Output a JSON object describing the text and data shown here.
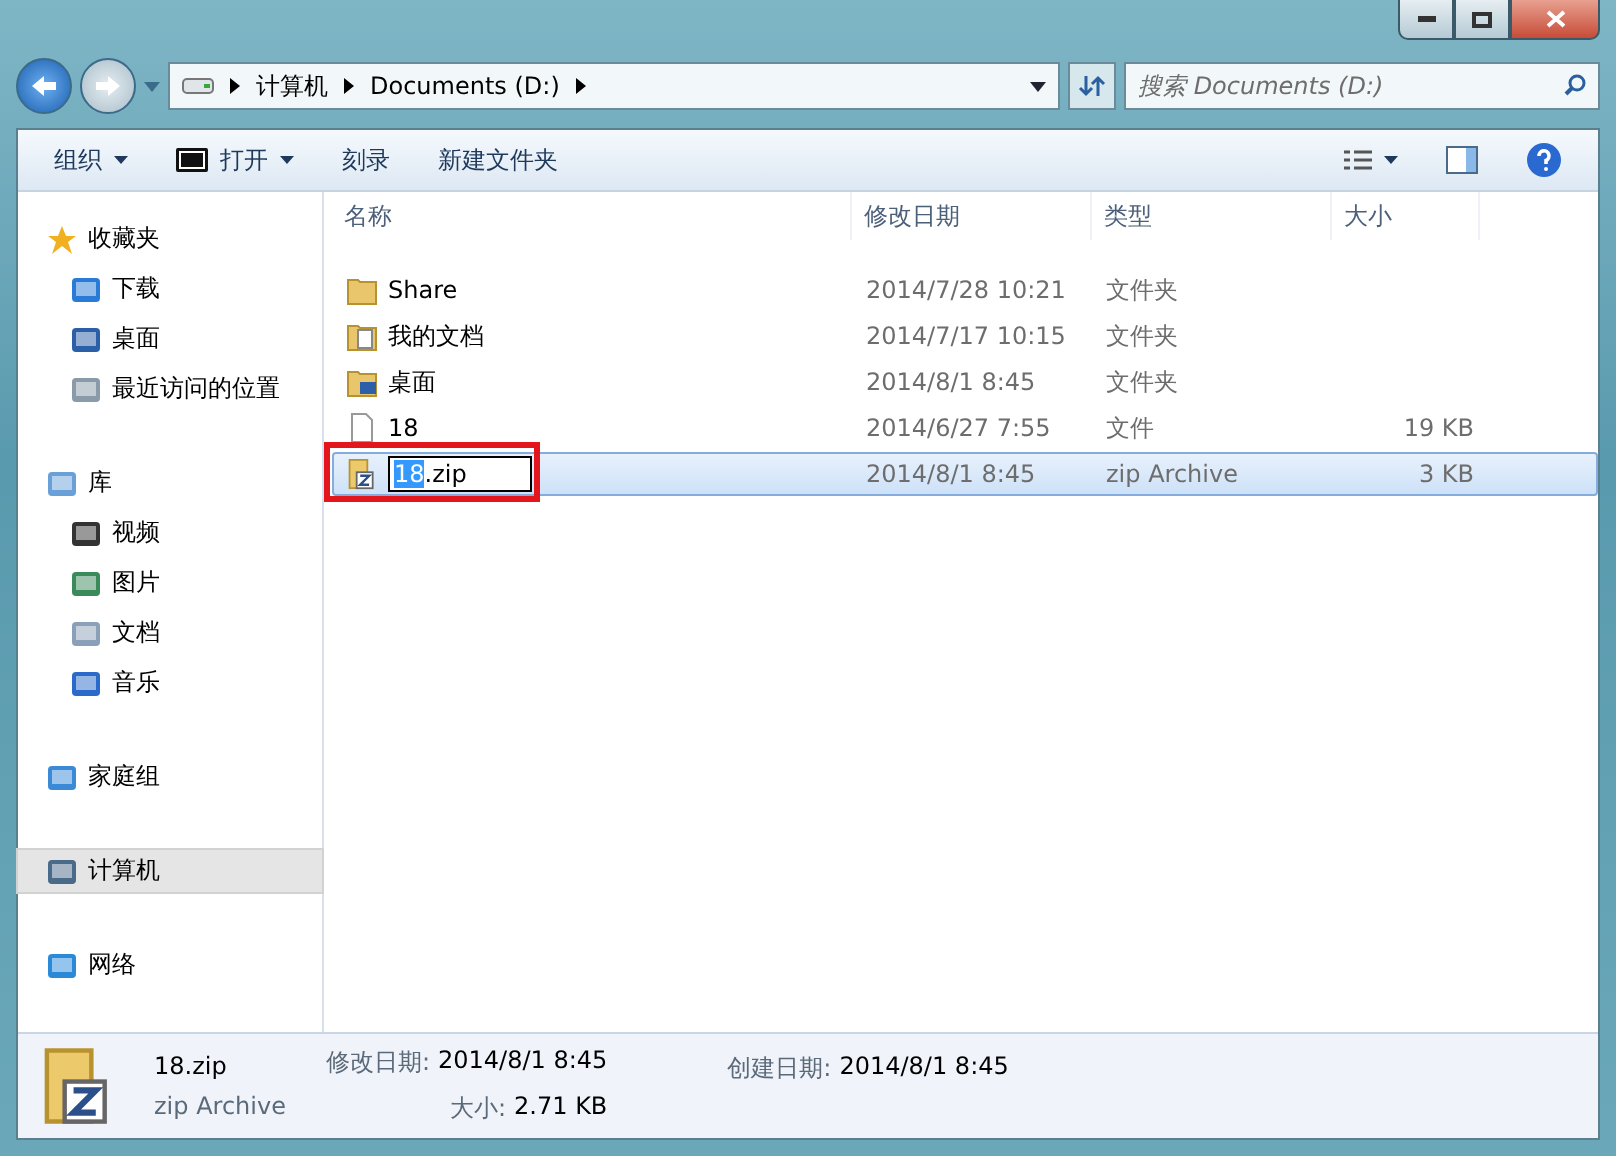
{
  "address_bar": {
    "crumbs": [
      "计算机",
      "Documents (D:)"
    ]
  },
  "search": {
    "placeholder": "搜索 Documents (D:)"
  },
  "toolbar": {
    "items": [
      {
        "label": "组织",
        "kind": "menu"
      },
      {
        "label": "打开",
        "kind": "open"
      },
      {
        "label": "刻录",
        "kind": "plain"
      },
      {
        "label": "新建文件夹",
        "kind": "plain"
      }
    ]
  },
  "sidebar": {
    "groups": [
      {
        "label": "收藏夹",
        "selected": false,
        "children": [
          {
            "label": "下载",
            "selected": false
          },
          {
            "label": "桌面",
            "selected": false
          },
          {
            "label": "最近访问的位置",
            "selected": false
          }
        ]
      },
      {
        "label": "库",
        "selected": false,
        "children": [
          {
            "label": "视频",
            "selected": false
          },
          {
            "label": "图片",
            "selected": false
          },
          {
            "label": "文档",
            "selected": false
          },
          {
            "label": "音乐",
            "selected": false
          }
        ]
      },
      {
        "label": "家庭组",
        "selected": false
      },
      {
        "label": "计算机",
        "selected": true
      },
      {
        "label": "网络",
        "selected": false
      }
    ]
  },
  "table": {
    "columns": [
      "名称",
      "修改日期",
      "类型",
      "大小"
    ],
    "rows": [
      {
        "kind": "folder",
        "name": "Share",
        "modified": "2014/7/28 10:21",
        "type": "文件夹",
        "size": "",
        "selected": false,
        "renaming": false
      },
      {
        "kind": "docs-folder",
        "name": "我的文档",
        "modified": "2014/7/17 10:15",
        "type": "文件夹",
        "size": "",
        "selected": false,
        "renaming": false
      },
      {
        "kind": "desktop-folder",
        "name": "桌面",
        "modified": "2014/8/1 8:45",
        "type": "文件夹",
        "size": "",
        "selected": false,
        "renaming": false
      },
      {
        "kind": "file",
        "name": "18",
        "modified": "2014/6/27 7:55",
        "type": "文件",
        "size": "19 KB",
        "selected": false,
        "renaming": false
      },
      {
        "kind": "zip",
        "name_selected_part": "18",
        "name_rest": ".zip",
        "modified": "2014/8/1 8:45",
        "type": "zip Archive",
        "size": "3 KB",
        "selected": true,
        "renaming": true
      }
    ]
  },
  "details": {
    "name": "18.zip",
    "type": "zip Archive",
    "fields": [
      {
        "label": "修改日期:",
        "value": "2014/8/1 8:45"
      },
      {
        "label": "大小:",
        "value": "2.71 KB"
      },
      {
        "label": "创建日期:",
        "value": "2014/8/1 8:45"
      }
    ]
  }
}
